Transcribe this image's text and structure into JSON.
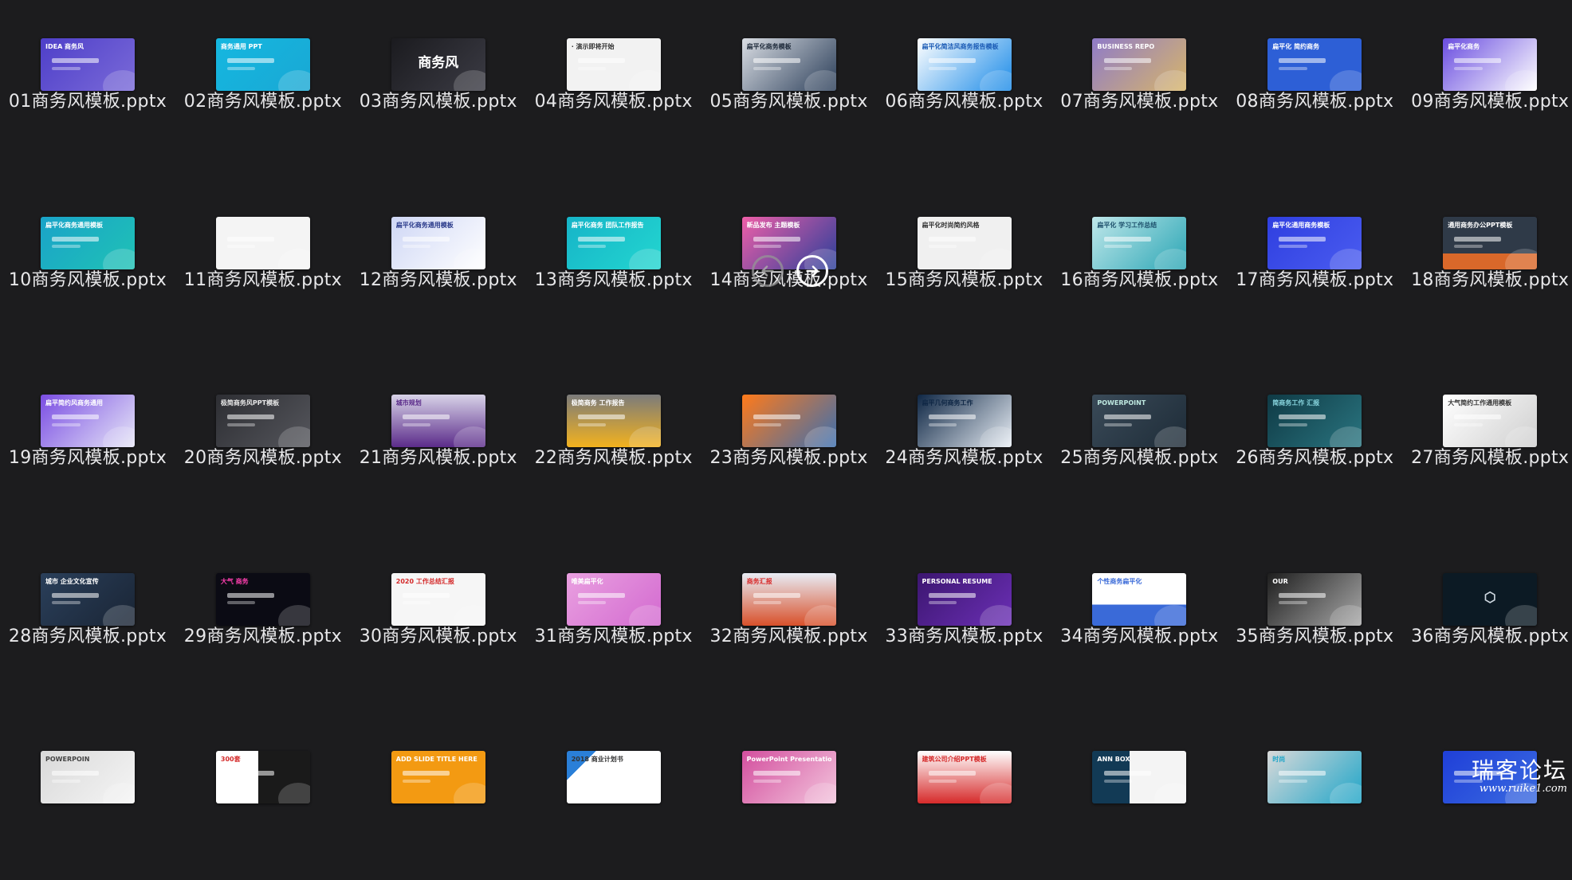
{
  "files": [
    {
      "name": "01商务风模板.pptx",
      "thumb": {
        "bg": "linear-gradient(135deg,#4e3fc9,#7a6ad8)",
        "text": "IDEA 商务风",
        "fg": "#ffffff"
      }
    },
    {
      "name": "02商务风模板.pptx",
      "thumb": {
        "bg": "linear-gradient(135deg,#15b7e0,#19a8d4)",
        "text": "商务通用 PPT",
        "fg": "#ffffff"
      }
    },
    {
      "name": "03商务风模板.pptx",
      "thumb": {
        "bg": "linear-gradient(135deg,#1b1b1f,#3b3b44)",
        "text": "商务风",
        "fg": "#ffffff",
        "big": true
      }
    },
    {
      "name": "04商务风模板.pptx",
      "thumb": {
        "bg": "#f2f2f2",
        "text": "· 演示即将开始",
        "fg": "#333333"
      }
    },
    {
      "name": "05商务风模板.pptx",
      "thumb": {
        "bg": "linear-gradient(135deg,#d9dde3,#2b3e59)",
        "text": "扁平化商务模板",
        "fg": "#1e2a3a"
      }
    },
    {
      "name": "06商务风模板.pptx",
      "thumb": {
        "bg": "linear-gradient(135deg,#ffffff,#1b8be8)",
        "text": "扁平化简洁风商务报告模板",
        "fg": "#1b5bb5"
      }
    },
    {
      "name": "07商务风模板.pptx",
      "thumb": {
        "bg": "linear-gradient(135deg,#8f7bc8,#d7b56a)",
        "text": "BUSINESS REPO",
        "fg": "#ffffff"
      }
    },
    {
      "name": "08商务风模板.pptx",
      "thumb": {
        "bg": "#2d5fd6",
        "text": "扁平化 简约商务",
        "fg": "#ffffff"
      }
    },
    {
      "name": "09商务风模板.pptx",
      "thumb": {
        "bg": "linear-gradient(135deg,#6a4de0,#ffffff)",
        "text": "扁平化商务",
        "fg": "#ffffff"
      }
    },
    {
      "name": "10商务风模板.pptx",
      "thumb": {
        "bg": "linear-gradient(135deg,#1aa3c9,#1fc2b5)",
        "text": "扁平化商务通用模板",
        "fg": "#ffffff"
      }
    },
    {
      "name": "11商务风模板.pptx",
      "thumb": {
        "bg": "#f4f4f4",
        "text": "",
        "fg": "#333333"
      }
    },
    {
      "name": "12商务风模板.pptx",
      "thumb": {
        "bg": "linear-gradient(135deg,#cfd7f5,#ffffff)",
        "text": "扁平化商务通用模板",
        "fg": "#2a3a8a"
      }
    },
    {
      "name": "13商务风模板.pptx",
      "thumb": {
        "bg": "linear-gradient(135deg,#16b4c8,#23d6d0)",
        "text": "扁平化商务 团队工作报告",
        "fg": "#ffffff"
      }
    },
    {
      "name": "14商务风模板.pptx",
      "thumb": {
        "bg": "linear-gradient(135deg,#ee5fa8,#2a3f9a)",
        "text": "新品发布 主题模板",
        "fg": "#ffffff"
      }
    },
    {
      "name": "15商务风模板.pptx",
      "thumb": {
        "bg": "#f0f0f0",
        "text": "扁平化时尚简约风格",
        "fg": "#333333"
      }
    },
    {
      "name": "16商务风模板.pptx",
      "thumb": {
        "bg": "linear-gradient(135deg,#bfe7ea,#2ba6b5)",
        "text": "扁平化 学习工作总结",
        "fg": "#1d4f6b"
      }
    },
    {
      "name": "17商务风模板.pptx",
      "thumb": {
        "bg": "linear-gradient(135deg,#2f3fe0,#4a5cf0)",
        "text": "扁平化通用商务模板",
        "fg": "#ffffff"
      }
    },
    {
      "name": "18商务风模板.pptx",
      "thumb": {
        "bg": "linear-gradient(180deg,#2f3a48 70%,#d9682a 70%)",
        "text": "通用商务办公PPT模板",
        "fg": "#ffffff"
      }
    },
    {
      "name": "19商务风模板.pptx",
      "thumb": {
        "bg": "linear-gradient(135deg,#7a4de3,#e6e6f7)",
        "text": "扁平简约风商务通用",
        "fg": "#ffffff"
      }
    },
    {
      "name": "20商务风模板.pptx",
      "thumb": {
        "bg": "linear-gradient(135deg,#2d2e33,#55565c)",
        "text": "极简商务风PPT模板",
        "fg": "#e8e8e8"
      }
    },
    {
      "name": "21商务风模板.pptx",
      "thumb": {
        "bg": "linear-gradient(180deg,#d8d3e8,#5b2b8a)",
        "text": "城市规划",
        "fg": "#5b2b8a"
      }
    },
    {
      "name": "22商务风模板.pptx",
      "thumb": {
        "bg": "linear-gradient(180deg,#7b7b7b,#f3b21e)",
        "text": "极简商务 工作报告",
        "fg": "#ffffff"
      }
    },
    {
      "name": "23商务风模板.pptx",
      "thumb": {
        "bg": "linear-gradient(135deg,#ff7a1a,#3b6fb0)",
        "text": "",
        "fg": "#ffffff"
      }
    },
    {
      "name": "24商务风模板.pptx",
      "thumb": {
        "bg": "linear-gradient(135deg,#0f2745,#e8eef5)",
        "text": "扁平几何商务工作",
        "fg": "#0f2745"
      }
    },
    {
      "name": "25商务风模板.pptx",
      "thumb": {
        "bg": "linear-gradient(135deg,#3a4a58,#1e2c38)",
        "text": "POWERPOINT",
        "fg": "#bfe9e1"
      }
    },
    {
      "name": "26商务风模板.pptx",
      "thumb": {
        "bg": "linear-gradient(135deg,#0f3a45,#2a7580)",
        "text": "简商务工作 汇报",
        "fg": "#8ad7e0"
      }
    },
    {
      "name": "27商务风模板.pptx",
      "thumb": {
        "bg": "linear-gradient(135deg,#ffffff,#cfcfcf)",
        "text": "大气简约工作通用模板",
        "fg": "#333333"
      }
    },
    {
      "name": "28商务风模板.pptx",
      "thumb": {
        "bg": "linear-gradient(135deg,#2a3f5a,#1a2535)",
        "text": "城市 企业文化宣传",
        "fg": "#ffffff"
      }
    },
    {
      "name": "29商务风模板.pptx",
      "thumb": {
        "bg": "#0b0b14",
        "text": "大气 商务",
        "fg": "#ff3fb0"
      }
    },
    {
      "name": "30商务风模板.pptx",
      "thumb": {
        "bg": "#f6f6f6",
        "text": "2020 工作总结汇报",
        "fg": "#d42a2a"
      }
    },
    {
      "name": "31商务风模板.pptx",
      "thumb": {
        "bg": "linear-gradient(135deg,#e9a0e0,#d36ad0)",
        "text": "唯美扁平化",
        "fg": "#ffffff"
      }
    },
    {
      "name": "32商务风模板.pptx",
      "thumb": {
        "bg": "linear-gradient(180deg,#e8ecf5,#d8502a)",
        "text": "商务汇报",
        "fg": "#d82a2a"
      }
    },
    {
      "name": "33商务风模板.pptx",
      "thumb": {
        "bg": "linear-gradient(135deg,#3c1670,#6b2fb5)",
        "text": "PERSONAL RESUME",
        "fg": "#ffffff"
      }
    },
    {
      "name": "34商务风模板.pptx",
      "thumb": {
        "bg": "linear-gradient(180deg,#ffffff 60%,#3a6ad8 60%)",
        "text": "个性商务扁平化",
        "fg": "#3a6ad8"
      }
    },
    {
      "name": "35商务风模板.pptx",
      "thumb": {
        "bg": "linear-gradient(135deg,#1e1e1e,#a9a9a9)",
        "text": "OUR",
        "fg": "#ffffff"
      }
    },
    {
      "name": "36商务风模板.pptx",
      "thumb": {
        "bg": "#0c1a24",
        "text": "⬡",
        "fg": "#cfd8e0",
        "big": true
      }
    },
    {
      "name": "",
      "thumb": {
        "bg": "linear-gradient(135deg,#d9d9d9,#f5f5f5)",
        "text": "POWERPOIN",
        "fg": "#444444"
      }
    },
    {
      "name": "",
      "thumb": {
        "bg": "linear-gradient(90deg,#ffffff 45%,#1a1a1a 45%)",
        "text": "300套",
        "fg": "#d42a2a"
      }
    },
    {
      "name": "",
      "thumb": {
        "bg": "#f39a12",
        "text": "ADD SLIDE TITLE HERE",
        "fg": "#ffffff"
      }
    },
    {
      "name": "",
      "thumb": {
        "bg": "linear-gradient(135deg,#2a7fd8 20%,#ffffff 20%)",
        "text": "2018 商业计划书",
        "fg": "#333333"
      }
    },
    {
      "name": "",
      "thumb": {
        "bg": "linear-gradient(135deg,#d34f9e,#f3c5dd)",
        "text": "PowerPoint Presentation Template",
        "fg": "#ffffff"
      }
    },
    {
      "name": "",
      "thumb": {
        "bg": "linear-gradient(180deg,#ffffff,#d62a2a)",
        "text": "建筑公司介绍PPT模板",
        "fg": "#d62a2a"
      }
    },
    {
      "name": "",
      "thumb": {
        "bg": "linear-gradient(90deg,#123a55 40%,#f4f4f4 40%)",
        "text": "ANN BOX",
        "fg": "#ffffff"
      }
    },
    {
      "name": "",
      "thumb": {
        "bg": "linear-gradient(135deg,#d9d9d9,#1ea5c8)",
        "text": "时尚",
        "fg": "#1ea5c8"
      }
    },
    {
      "name": "",
      "thumb": {
        "bg": "linear-gradient(135deg,#1f3fd8,#3a6ae0)",
        "text": "",
        "fg": "#ffffff"
      }
    }
  ],
  "nav": {
    "prev_icon": "arrow-left-icon",
    "next_icon": "arrow-right-icon"
  },
  "watermark": {
    "logo": "瑞客论坛",
    "url": "www.ruike1.com"
  }
}
